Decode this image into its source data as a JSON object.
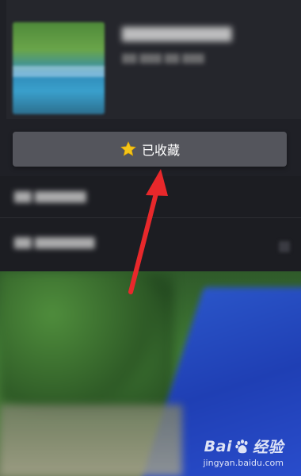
{
  "favorite": {
    "label": "已收藏",
    "star_color": "#f5c518"
  },
  "annotation": {
    "color": "#e8282b"
  },
  "watermark": {
    "brand_left": "Bai",
    "brand_right": "经验",
    "url": "jingyan.baidu.com"
  }
}
